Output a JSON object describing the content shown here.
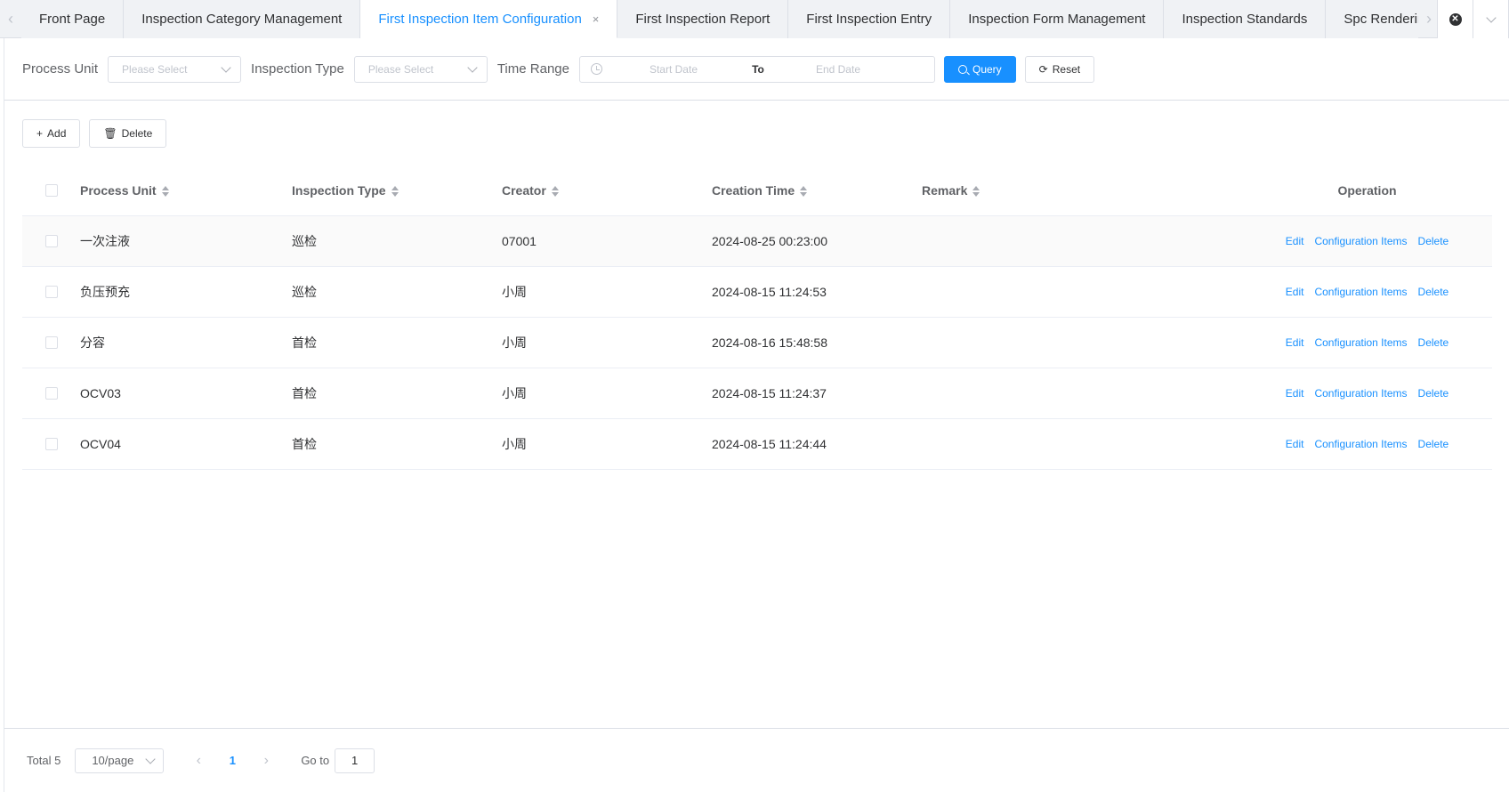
{
  "tabs": [
    {
      "label": "Front Page",
      "active": false
    },
    {
      "label": "Inspection Category Management",
      "active": false
    },
    {
      "label": "First Inspection Item Configuration",
      "active": true
    },
    {
      "label": "First Inspection Report",
      "active": false
    },
    {
      "label": "First Inspection Entry",
      "active": false
    },
    {
      "label": "Inspection Form Management",
      "active": false
    },
    {
      "label": "Inspection Standards",
      "active": false
    },
    {
      "label": "Spc Rendering Condit",
      "active": false
    }
  ],
  "active_tab_close": "×",
  "filter": {
    "process_unit_label": "Process Unit",
    "process_unit_placeholder": "Please Select",
    "inspection_type_label": "Inspection Type",
    "inspection_type_placeholder": "Please Select",
    "time_range_label": "Time Range",
    "start_placeholder": "Start Date",
    "to_label": "To",
    "end_placeholder": "End Date",
    "query_label": "Query",
    "reset_label": "Reset"
  },
  "actions": {
    "add_label": "Add",
    "delete_label": "Delete"
  },
  "table": {
    "headers": {
      "process_unit": "Process Unit",
      "inspection_type": "Inspection Type",
      "creator": "Creator",
      "creation_time": "Creation Time",
      "remark": "Remark",
      "operation": "Operation"
    },
    "rows": [
      {
        "process_unit": "一次注液",
        "inspection_type": "巡检",
        "creator": "07001",
        "creation_time": "2024-08-25 00:23:00",
        "remark": ""
      },
      {
        "process_unit": "负压预充",
        "inspection_type": "巡检",
        "creator": "小周",
        "creation_time": "2024-08-15 11:24:53",
        "remark": ""
      },
      {
        "process_unit": "分容",
        "inspection_type": "首检",
        "creator": "小周",
        "creation_time": "2024-08-16 15:48:58",
        "remark": ""
      },
      {
        "process_unit": "OCV03",
        "inspection_type": "首检",
        "creator": "小周",
        "creation_time": "2024-08-15 11:24:37",
        "remark": ""
      },
      {
        "process_unit": "OCV04",
        "inspection_type": "首检",
        "creator": "小周",
        "creation_time": "2024-08-15 11:24:44",
        "remark": ""
      }
    ],
    "op_labels": {
      "edit": "Edit",
      "config": "Configuration Items",
      "delete": "Delete"
    }
  },
  "pagination": {
    "total_label": "Total 5",
    "page_size": "10/page",
    "current_page": "1",
    "goto_label": "Go to",
    "goto_value": "1"
  },
  "colors": {
    "accent": "#1890ff",
    "border": "#dcdfe6"
  }
}
